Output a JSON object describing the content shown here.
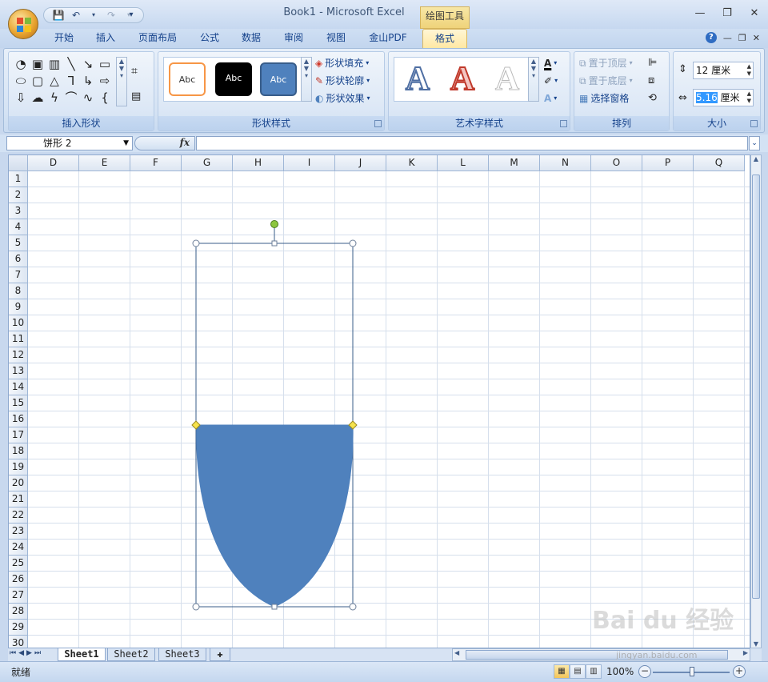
{
  "window": {
    "title": "Book1 - Microsoft Excel",
    "contextual_tab_label": "绘图工具",
    "minimize": "—",
    "restore": "❐",
    "close": "✕"
  },
  "tabs": [
    {
      "label": "开始"
    },
    {
      "label": "插入"
    },
    {
      "label": "页面布局"
    },
    {
      "label": "公式"
    },
    {
      "label": "数据"
    },
    {
      "label": "审阅"
    },
    {
      "label": "视图"
    },
    {
      "label": "金山PDF"
    },
    {
      "label": "格式",
      "active": true
    }
  ],
  "ribbon": {
    "groups": {
      "insert_shapes": {
        "label": "插入形状"
      },
      "shape_styles": {
        "label": "形状样式",
        "style_sample_text": "Abc",
        "fill_label": "形状填充",
        "outline_label": "形状轮廓",
        "effects_label": "形状效果"
      },
      "wordart_styles": {
        "label": "艺术字样式",
        "sample_letter": "A"
      },
      "arrange": {
        "label": "排列",
        "bring_front_label": "置于顶层",
        "send_back_label": "置于底层",
        "selection_pane_label": "选择窗格"
      },
      "size": {
        "label": "大小",
        "height_value": "12 厘米",
        "width_value_selected": "5.16",
        "width_unit": "厘米"
      }
    }
  },
  "formula_bar": {
    "name_box": "饼形 2",
    "fx_label": "fx",
    "content": ""
  },
  "grid": {
    "columns": [
      "D",
      "E",
      "F",
      "G",
      "H",
      "I",
      "J",
      "K",
      "L",
      "M",
      "N",
      "O",
      "P",
      "Q"
    ],
    "rows": [
      "1",
      "2",
      "3",
      "4",
      "5",
      "6",
      "7",
      "8",
      "9",
      "10",
      "11",
      "12",
      "13",
      "14",
      "15",
      "16",
      "17",
      "18",
      "19",
      "20",
      "21",
      "22",
      "23",
      "24",
      "25",
      "26",
      "27",
      "28",
      "29",
      "30"
    ]
  },
  "shape": {
    "name": "饼形 2",
    "fill_color": "#4f81bd",
    "outline_color": "#4f81bd",
    "selection_color": "#385d8a",
    "rotation_handle_color": "#8dc63f",
    "adjust_handle_color": "#f7e34c"
  },
  "sheets": [
    {
      "label": "Sheet1",
      "active": true
    },
    {
      "label": "Sheet2"
    },
    {
      "label": "Sheet3"
    }
  ],
  "status": {
    "ready_text": "就绪",
    "zoom": "100%"
  },
  "watermark": {
    "text": "Bai du 经验",
    "url": "jingyan.baidu.com"
  }
}
